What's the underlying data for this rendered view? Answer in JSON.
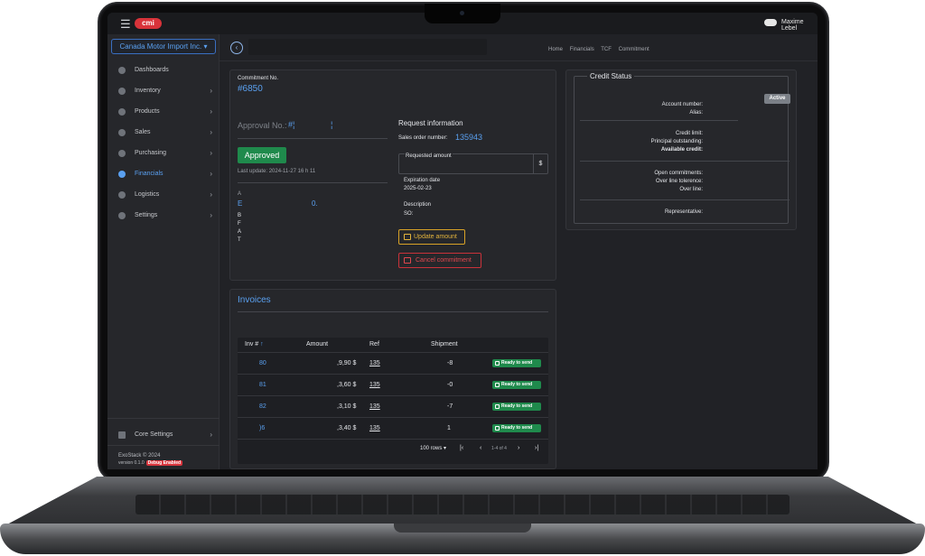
{
  "topbar": {
    "menu_icon": "☰",
    "logo": "cmi",
    "user_name": "Maxime Lebel"
  },
  "sidebar": {
    "company": "Canada Motor Import Inc. ▾",
    "items": [
      {
        "label": "Dashboards",
        "icon": "dashboard-icon",
        "has_chevron": false
      },
      {
        "label": "Inventory",
        "icon": "inventory-icon",
        "has_chevron": true
      },
      {
        "label": "Products",
        "icon": "products-icon",
        "has_chevron": true
      },
      {
        "label": "Sales",
        "icon": "cart-icon",
        "has_chevron": true
      },
      {
        "label": "Purchasing",
        "icon": "purchasing-icon",
        "has_chevron": true
      },
      {
        "label": "Financials",
        "icon": "financials-icon",
        "has_chevron": true,
        "active": true
      },
      {
        "label": "Logistics",
        "icon": "truck-icon",
        "has_chevron": true
      },
      {
        "label": "Settings",
        "icon": "settings-icon",
        "has_chevron": true
      }
    ],
    "core_settings": "Core Settings",
    "brand": "ExoStack © 2024",
    "version": "version 0.1.0",
    "debug": "Debug Enabled"
  },
  "header": {
    "back": "‹",
    "breadcrumbs": [
      "Home",
      "Financials",
      "TCF",
      "Commitment"
    ]
  },
  "commitment": {
    "label": "Commitment No.",
    "number": "#6850",
    "approval_label": "Approval No.:",
    "approval_value": "#¦",
    "approval_suffix": "¦",
    "status": "Approved",
    "last_update": "Last update: 2024-11-27 16 h 11",
    "partial_a": "A",
    "partial_link_start": "E",
    "partial_link_end": "0.",
    "partial_letters": [
      "B",
      "F",
      "A",
      "T"
    ]
  },
  "request": {
    "title": "Request information",
    "sales_order_label": "Sales order number:",
    "sales_order_value": "135943",
    "requested_amount_label": "Requested amount",
    "currency": "$",
    "expiration_label": "Expiration date",
    "expiration_value": "2025-02-23",
    "description_label": "Description",
    "so_label": "SO:",
    "update_button": "Update amount",
    "cancel_button": "Cancel commitment"
  },
  "invoices": {
    "title": "Invoices",
    "columns": [
      "Inv #",
      "Amount",
      "Ref",
      "Shipment"
    ],
    "sort_indicator": "↑",
    "rows": [
      {
        "inv": "80",
        "amount": ",9,90 $",
        "ref": "135",
        "shipment": "-8",
        "status": "Ready to send"
      },
      {
        "inv": "81",
        "amount": ",3,60 $",
        "ref": "135",
        "shipment": "-0",
        "status": "Ready to send"
      },
      {
        "inv": "82",
        "amount": ",3,10 $",
        "ref": "135",
        "shipment": "-7",
        "status": "Ready to send"
      },
      {
        "inv": ")6",
        "amount": ",3,40 $",
        "ref": "135",
        "shipment": "1",
        "status": "Ready to send"
      }
    ],
    "rows_per_page": "100 rows ▾",
    "pager_first": "|‹",
    "pager_prev": "‹",
    "page_info": "1-4 of 4",
    "pager_next": "›",
    "pager_last": "›|"
  },
  "credit": {
    "title": "Credit Status",
    "badge": "Active",
    "account_number": "Account number:",
    "alias": "Alias:",
    "credit_limit": "Credit limit:",
    "principal_outstanding": "Principal outstanding:",
    "available_credit": "Available credit:",
    "open_commitments": "Open commitments:",
    "over_line_tolerance": "Over line tolerence:",
    "over_line": "Over line:",
    "representative": "Representative:"
  }
}
